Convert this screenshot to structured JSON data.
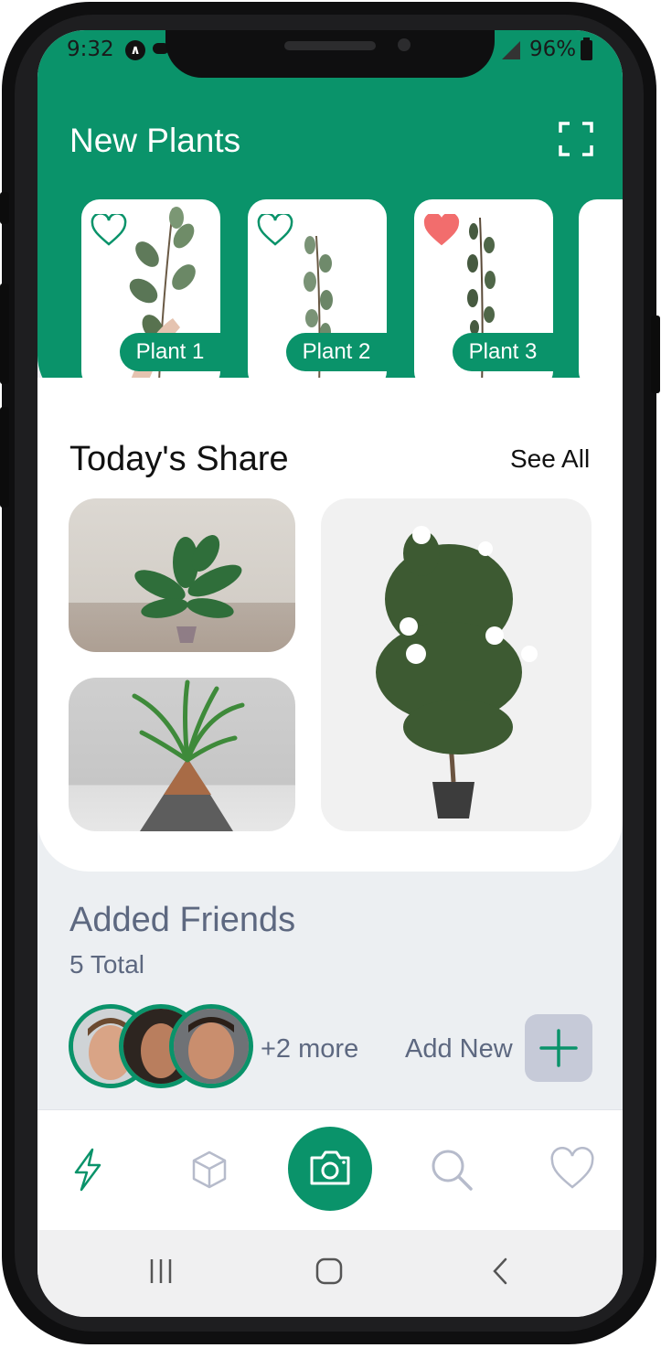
{
  "status_bar": {
    "time": "9:32",
    "battery": "96%"
  },
  "header": {
    "title": "New Plants"
  },
  "new_plants": [
    {
      "label": "Plant 1",
      "favorited": false
    },
    {
      "label": "Plant 2",
      "favorited": false
    },
    {
      "label": "Plant 3",
      "favorited": true
    }
  ],
  "todays_share": {
    "title": "Today's Share",
    "see_all": "See All"
  },
  "friends": {
    "title": "Added Friends",
    "total": "5 Total",
    "more": "+2 more",
    "add_new": "Add New"
  },
  "tabbar": {
    "items": [
      "lightning-icon",
      "cube-icon",
      "camera-icon",
      "search-icon",
      "heart-icon"
    ]
  },
  "colors": {
    "primary": "#0a936a",
    "muted_text": "#5d6880",
    "favorite": "#f26d6d",
    "add_button": "#c6cad8"
  }
}
